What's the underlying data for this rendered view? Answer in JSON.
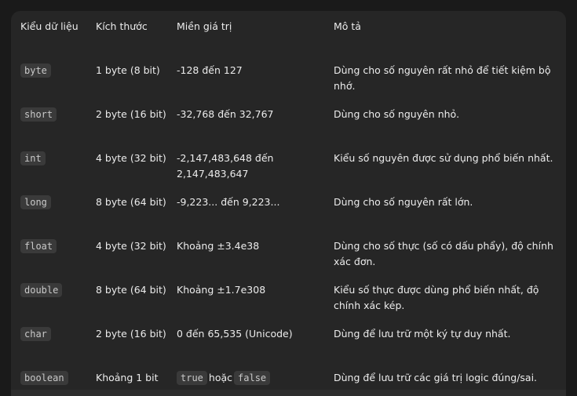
{
  "table": {
    "headers": [
      "Kiểu dữ liệu",
      "Kích thước",
      "Miền giá trị",
      "Mô tả"
    ],
    "rows": [
      {
        "type": "byte",
        "size": "1 byte (8 bit)",
        "range": "-128 đến 127",
        "desc": "Dùng cho số nguyên rất nhỏ để tiết kiệm bộ nhớ."
      },
      {
        "type": "short",
        "size": "2 byte (16 bit)",
        "range": "-32,768 đến 32,767",
        "desc": "Dùng cho số nguyên nhỏ."
      },
      {
        "type": "int",
        "size": "4 byte (32 bit)",
        "range": "-2,147,483,648 đến 2,147,483,647",
        "desc": "Kiểu số nguyên được sử dụng phổ biến nhất."
      },
      {
        "type": "long",
        "size": "8 byte (64 bit)",
        "range": "-9,223... đến 9,223...",
        "desc": "Dùng cho số nguyên rất lớn."
      },
      {
        "type": "float",
        "size": "4 byte (32 bit)",
        "range": "Khoảng ±3.4e38",
        "desc": "Dùng cho số thực (số có dấu phẩy), độ chính xác đơn."
      },
      {
        "type": "double",
        "size": "8 byte (64 bit)",
        "range": "Khoảng ±1.7e308",
        "desc": "Kiểu số thực được dùng phổ biến nhất, độ chính xác kép."
      },
      {
        "type": "char",
        "size": "2 byte (16 bit)",
        "range": "0 đến 65,535 (Unicode)",
        "desc": "Dùng để lưu trữ một ký tự duy nhất."
      },
      {
        "type": "boolean",
        "size": "Khoảng 1 bit",
        "range_true": "true",
        "range_or": "hoặc",
        "range_false": "false",
        "desc": "Dùng để lưu trữ các giá trị logic đúng/sai."
      }
    ]
  }
}
